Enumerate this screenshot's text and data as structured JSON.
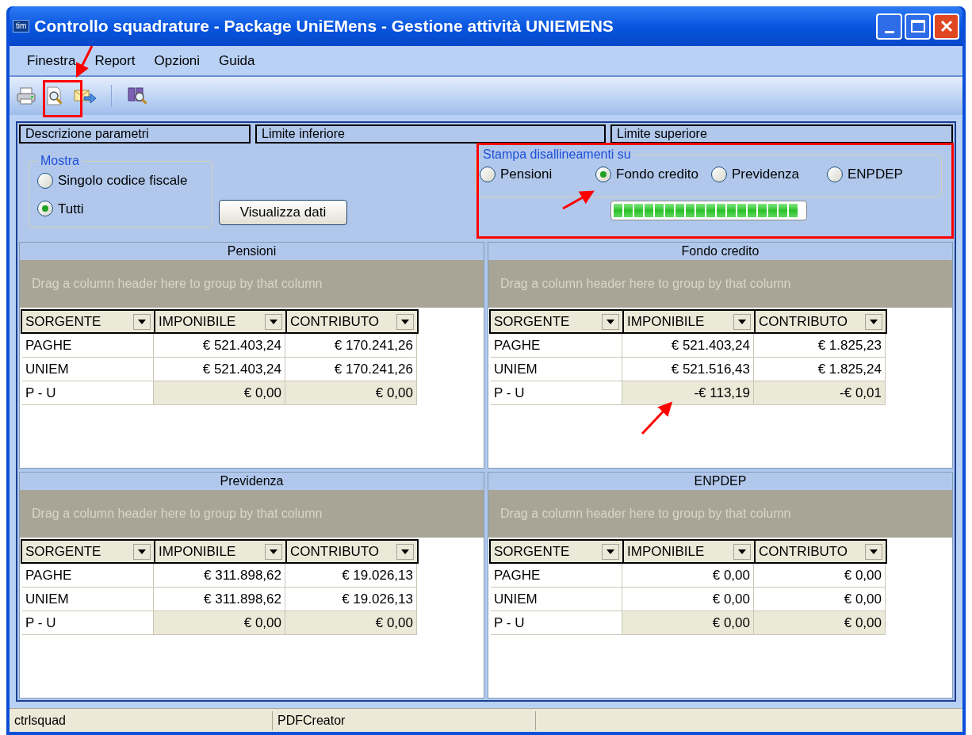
{
  "window": {
    "title": "Controllo squadrature - Package UniEMens - Gestione attività UNIEMENS",
    "logo": "tim"
  },
  "menu": [
    {
      "label": "Finestra"
    },
    {
      "label": "Report"
    },
    {
      "label": "Opzioni"
    },
    {
      "label": "Guida"
    }
  ],
  "toolbar": [
    {
      "kind": "print"
    },
    {
      "kind": "preview"
    },
    {
      "kind": "send"
    },
    {
      "kind": "separator"
    },
    {
      "kind": "search"
    }
  ],
  "parameters_header": [
    "Descrizione parametri",
    "Limite inferiore",
    "Limite superiore"
  ],
  "mostra": {
    "title": "Mostra",
    "options": [
      {
        "label": "Singolo codice fiscale",
        "selected": false
      },
      {
        "label": "Tutti",
        "selected": true
      }
    ]
  },
  "show_button": "Visualizza dati",
  "stampa": {
    "title": "Stampa disallineamenti su",
    "options": [
      {
        "label": "Pensioni",
        "selected": false
      },
      {
        "label": "Fondo credito",
        "selected": true
      },
      {
        "label": "Previdenza",
        "selected": false
      },
      {
        "label": "ENPDEP",
        "selected": false
      }
    ],
    "progress": {
      "level": 1
    }
  },
  "grids": [
    {
      "title": "Pensioni",
      "group_hint": "Drag a column header here to group by that column",
      "columns": [
        "SORGENTE",
        "IMPONIBILE",
        "CONTRIBUTO"
      ],
      "rows": [
        {
          "kind": "data",
          "cells": [
            "PAGHE",
            "€ 521.403,24",
            "€ 170.241,26"
          ]
        },
        {
          "kind": "data",
          "cells": [
            "UNIEM",
            "€ 521.403,24",
            "€ 170.241,26"
          ]
        },
        {
          "kind": "total",
          "cells": [
            "P - U",
            "€ 0,00",
            "€ 0,00"
          ]
        }
      ]
    },
    {
      "title": "Fondo credito",
      "group_hint": "Drag a column header here to group by that column",
      "columns": [
        "SORGENTE",
        "IMPONIBILE",
        "CONTRIBUTO"
      ],
      "rows": [
        {
          "kind": "data",
          "cells": [
            "PAGHE",
            "€ 521.403,24",
            "€ 1.825,23"
          ]
        },
        {
          "kind": "data",
          "cells": [
            "UNIEM",
            "€ 521.516,43",
            "€ 1.825,24"
          ]
        },
        {
          "kind": "total",
          "cells": [
            "P - U",
            "-€ 113,19",
            "-€ 0,01"
          ]
        }
      ]
    },
    {
      "title": "Previdenza",
      "group_hint": "Drag a column header here to group by that column",
      "columns": [
        "SORGENTE",
        "IMPONIBILE",
        "CONTRIBUTO"
      ],
      "rows": [
        {
          "kind": "data",
          "cells": [
            "PAGHE",
            "€ 311.898,62",
            "€ 19.026,13"
          ]
        },
        {
          "kind": "data",
          "cells": [
            "UNIEM",
            "€ 311.898,62",
            "€ 19.026,13"
          ]
        },
        {
          "kind": "total",
          "cells": [
            "P - U",
            "€ 0,00",
            "€ 0,00"
          ]
        }
      ]
    },
    {
      "title": "ENPDEP",
      "group_hint": "Drag a column header here to group by that column",
      "columns": [
        "SORGENTE",
        "IMPONIBILE",
        "CONTRIBUTO"
      ],
      "rows": [
        {
          "kind": "data",
          "cells": [
            "PAGHE",
            "€ 0,00",
            "€ 0,00"
          ]
        },
        {
          "kind": "data",
          "cells": [
            "UNIEM",
            "€ 0,00",
            "€ 0,00"
          ]
        },
        {
          "kind": "total",
          "cells": [
            "P - U",
            "€ 0,00",
            "€ 0,00"
          ]
        }
      ]
    }
  ],
  "status_bar": [
    "ctrlsquad",
    "PDFCreator"
  ]
}
